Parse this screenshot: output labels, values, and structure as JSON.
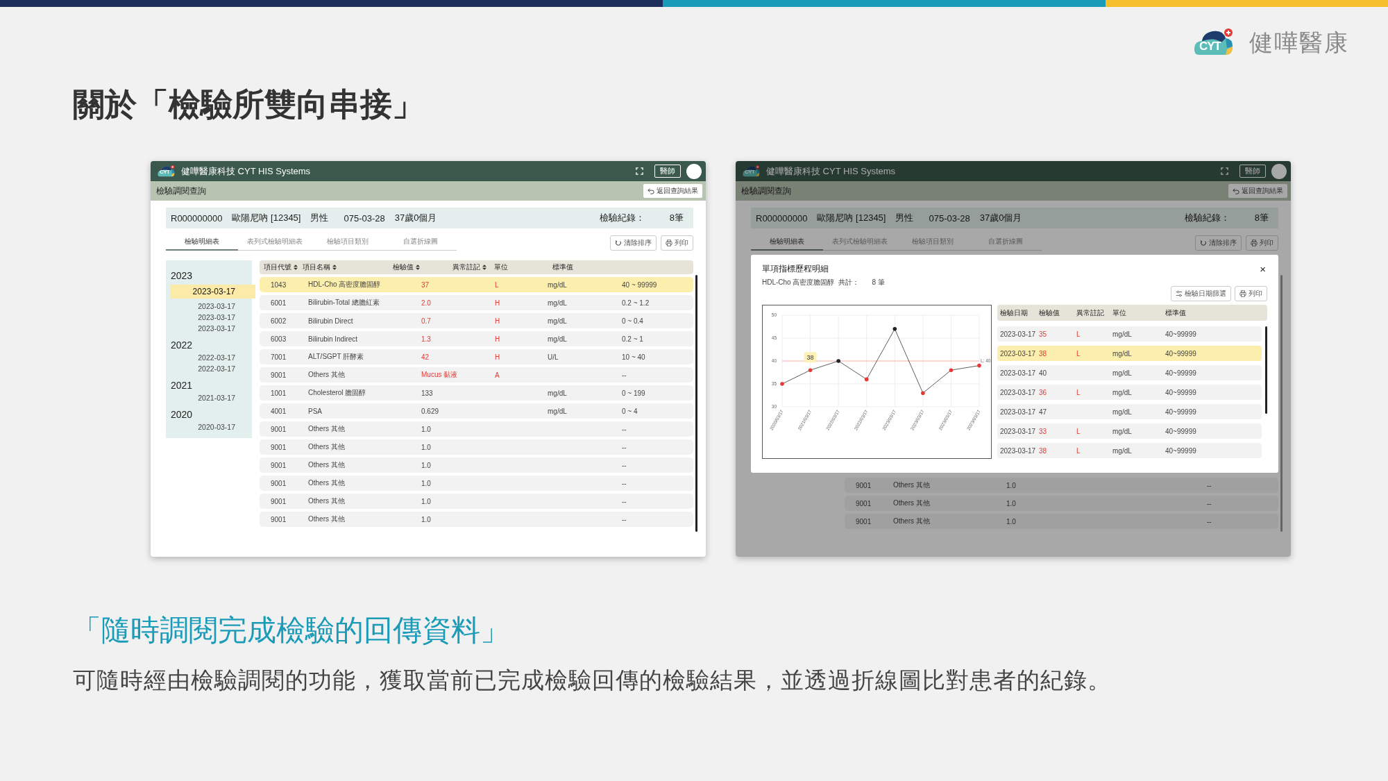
{
  "brand": {
    "logo_text": "CYT",
    "name": "健嘩醫康"
  },
  "title": "關於「檢驗所雙向串接」",
  "screens": [
    {
      "kind": "detail",
      "app_logo": "CYT",
      "app_title": "健嘩醫康科技 CYT HIS Systems",
      "role": "醫師",
      "page_title": "檢驗調閱查詢",
      "back_button": "返回查詢結果",
      "patient": {
        "id": "R000000000",
        "name": "歐陽尼吶 [12345]",
        "sex": "男性",
        "birth": "075-03-28",
        "age": "37歲0個月",
        "records_label": "檢驗紀錄：",
        "records_count": "8筆"
      },
      "tabs": [
        {
          "label": "檢驗明細表",
          "selected": true
        },
        {
          "label": "表列式檢驗明細表",
          "selected": false
        },
        {
          "label": "檢驗項目類別",
          "selected": false
        },
        {
          "label": "自選折線圖",
          "selected": false
        }
      ],
      "actions": [
        {
          "kind": "clear-sort",
          "label": "清除排序"
        },
        {
          "kind": "print",
          "label": "列印"
        }
      ],
      "sidebar": [
        {
          "year": "2023",
          "dates": [
            {
              "label": "2023-03-17",
              "selected": true
            },
            {
              "label": "2023-03-17",
              "selected": false
            },
            {
              "label": "2023-03-17",
              "selected": false
            },
            {
              "label": "2023-03-17",
              "selected": false
            }
          ]
        },
        {
          "year": "2022",
          "dates": [
            {
              "label": "2022-03-17",
              "selected": false
            },
            {
              "label": "2022-03-17",
              "selected": false
            }
          ]
        },
        {
          "year": "2021",
          "dates": [
            {
              "label": "2021-03-17",
              "selected": false
            }
          ]
        },
        {
          "year": "2020",
          "dates": [
            {
              "label": "2020-03-17",
              "selected": false
            }
          ]
        }
      ],
      "columns": [
        {
          "label": "項目代號",
          "sortable": true
        },
        {
          "label": "項目名稱",
          "sortable": true
        },
        {
          "label": "檢驗值",
          "sortable": true
        },
        {
          "label": "異常註記",
          "sortable": true
        },
        {
          "label": "單位",
          "sortable": false
        },
        {
          "label": "標準值",
          "sortable": false
        }
      ],
      "rows": [
        {
          "code": "1043",
          "name": "HDL-Cho 高密度膽固醇",
          "value": "37",
          "flag": "L",
          "unit": "mg/dL",
          "range": "40 ~ 99999",
          "abnormal": true,
          "selected": true
        },
        {
          "code": "6001",
          "name": "Bilirubin-Total 總膽紅素",
          "value": "2.0",
          "flag": "H",
          "unit": "mg/dL",
          "range": "0.2 ~ 1.2",
          "abnormal": true,
          "selected": false
        },
        {
          "code": "6002",
          "name": "Bilirubin Direct",
          "value": "0.7",
          "flag": "H",
          "unit": "mg/dL",
          "range": "0 ~ 0.4",
          "abnormal": true,
          "selected": false
        },
        {
          "code": "6003",
          "name": "Bilirubin Indirect",
          "value": "1.3",
          "flag": "H",
          "unit": "mg/dL",
          "range": "0.2 ~ 1",
          "abnormal": true,
          "selected": false
        },
        {
          "code": "7001",
          "name": "ALT/SGPT 肝酵素",
          "value": "42",
          "flag": "H",
          "unit": "U/L",
          "range": "10 ~ 40",
          "abnormal": true,
          "selected": false
        },
        {
          "code": "9001",
          "name": "Others 其他",
          "value": "Mucus 黏液",
          "flag": "A",
          "range": "--",
          "abnormal": true,
          "selected": false
        },
        {
          "code": "1001",
          "name": "Cholesterol 膽固醇",
          "value": "133",
          "unit": "mg/dL",
          "range": "0 ~ 199",
          "abnormal": false,
          "selected": false
        },
        {
          "code": "4001",
          "name": "PSA",
          "value": "0.629",
          "unit": "mg/dL",
          "range": "0 ~ 4",
          "abnormal": false,
          "selected": false
        },
        {
          "code": "9001",
          "name": "Others 其他",
          "value": "1.0",
          "range": "--",
          "abnormal": false,
          "selected": false
        },
        {
          "code": "9001",
          "name": "Others 其他",
          "value": "1.0",
          "range": "--",
          "abnormal": false,
          "selected": false
        },
        {
          "code": "9001",
          "name": "Others 其他",
          "value": "1.0",
          "range": "--",
          "abnormal": false,
          "selected": false
        },
        {
          "code": "9001",
          "name": "Others 其他",
          "value": "1.0",
          "range": "--",
          "abnormal": false,
          "selected": false
        },
        {
          "code": "9001",
          "name": "Others 其他",
          "value": "1.0",
          "range": "--",
          "abnormal": false,
          "selected": false
        },
        {
          "code": "9001",
          "name": "Others 其他",
          "value": "1.0",
          "range": "--",
          "abnormal": false,
          "selected": false
        }
      ]
    },
    {
      "kind": "trend",
      "app_logo": "CYT",
      "app_title": "健嘩醫康科技 CYT HIS Systems",
      "role": "醫師",
      "page_title": "檢驗調閱查詢",
      "back_button": "返回查詢結果",
      "patient": {
        "id": "R000000000",
        "name": "歐陽尼吶 [12345]",
        "sex": "男性",
        "birth": "075-03-28",
        "age": "37歲0個月",
        "records_label": "檢驗紀錄：",
        "records_count": "8筆"
      },
      "tabs": [
        {
          "label": "檢驗明細表",
          "selected": true
        },
        {
          "label": "表列式檢驗明細表",
          "selected": false
        },
        {
          "label": "檢驗項目類別",
          "selected": false
        },
        {
          "label": "自選折線圖",
          "selected": false
        }
      ],
      "actions": [
        {
          "kind": "clear-sort",
          "label": "清除排序"
        },
        {
          "kind": "print",
          "label": "列印"
        }
      ],
      "rows": [
        {
          "code": "9001",
          "name": "Others 其他",
          "value": "1.0",
          "range": "--",
          "abnormal": false,
          "selected": false
        },
        {
          "code": "9001",
          "name": "Others 其他",
          "value": "1.0",
          "range": "--",
          "abnormal": false,
          "selected": false
        },
        {
          "code": "9001",
          "name": "Others 其他",
          "value": "1.0",
          "range": "--",
          "abnormal": false,
          "selected": false
        }
      ],
      "modal": {
        "title": "單項指標歷程明細",
        "item": "HDL-Cho 高密度膽固醇",
        "total_label": "共計：",
        "total": "8 筆",
        "close": "×",
        "actions": [
          {
            "kind": "date-filter",
            "label": "檢驗日期篩選"
          },
          {
            "kind": "print",
            "label": "列印"
          }
        ],
        "chart_data": {
          "type": "line",
          "categories": [
            "2020/03/17",
            "2021/03/17",
            "2022/03/17",
            "2022/03/17",
            "2023/03/17",
            "2023/03/17",
            "2023/03/17",
            "2023/03/17"
          ],
          "series": [
            {
              "color": "#333333",
              "values": [
                35,
                38,
                40,
                36,
                47,
                33,
                38,
                39
              ]
            }
          ],
          "ylim": [
            30,
            50
          ],
          "yticks": [
            30,
            35,
            40,
            45,
            50
          ],
          "grid": true,
          "ref_lines": [
            {
              "axis": "y",
              "value": 40,
              "label": "L: 40",
              "color": "#f28b85"
            }
          ],
          "annotations": [
            {
              "text": "38",
              "x": "2021/03/17",
              "y": 38
            }
          ]
        },
        "columns": [
          "檢驗日期",
          "檢驗值",
          "異常註記",
          "單位",
          "標準值"
        ],
        "rows": [
          {
            "date": "2023-03-17",
            "value": "35",
            "flag": "L",
            "unit": "mg/dL",
            "range": "40~99999",
            "abnormal": true,
            "selected": false
          },
          {
            "date": "2023-03-17",
            "value": "38",
            "flag": "L",
            "unit": "mg/dL",
            "range": "40~99999",
            "abnormal": true,
            "selected": true
          },
          {
            "date": "2023-03-17",
            "value": "40",
            "unit": "mg/dL",
            "range": "40~99999",
            "abnormal": false,
            "selected": false
          },
          {
            "date": "2023-03-17",
            "value": "36",
            "flag": "L",
            "unit": "mg/dL",
            "range": "40~99999",
            "abnormal": true,
            "selected": false
          },
          {
            "date": "2023-03-17",
            "value": "47",
            "unit": "mg/dL",
            "range": "40~99999",
            "abnormal": false,
            "selected": false
          },
          {
            "date": "2023-03-17",
            "value": "33",
            "flag": "L",
            "unit": "mg/dL",
            "range": "40~99999",
            "abnormal": true,
            "selected": false
          },
          {
            "date": "2023-03-17",
            "value": "38",
            "flag": "L",
            "unit": "mg/dL",
            "range": "40~99999",
            "abnormal": true,
            "selected": false
          }
        ]
      }
    }
  ],
  "subtitle": "「隨時調閱完成檢驗的回傳資料」",
  "description": "可隨時經由檢驗調閱的功能，獲取當前已完成檢驗回傳的檢驗結果，並透過折線圖比對患者的紀錄。"
}
